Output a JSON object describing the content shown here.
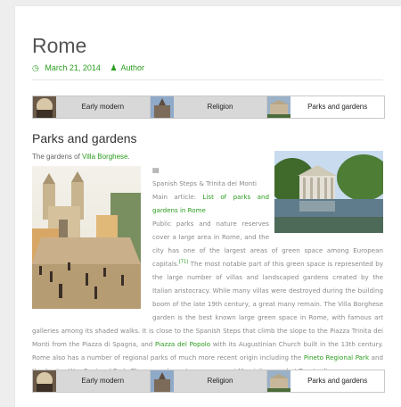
{
  "page": {
    "title": "Rome",
    "date": "March 21, 2014",
    "author": "Author"
  },
  "tabs": [
    {
      "label": "Early modern",
      "active": false
    },
    {
      "label": "Religion",
      "active": false
    },
    {
      "label": "Parks and gardens",
      "active": true
    }
  ],
  "section": {
    "heading": "Parks and gardens",
    "gardens_prefix": "The gardens of ",
    "gardens_link": "Villa Borghese",
    "gardens_suffix": ".",
    "caption": "Spanish Steps & Trinita dei Monti",
    "main_article_prefix": "Main article: ",
    "main_article_link": "List of parks and gardens in Rome",
    "p1": "Public parks and nature reserves cover a large area in Rome, and the city has one of the largest areas of green space among European capitals.",
    "cite": "[71]",
    "p2": " The most notable part of this green space is represented by the large number of villas and landscaped gardens created by the Italian aristocracy. While many villas were destroyed during the building boom of the late 19th century, a great many remain. The Villa Borghese garden is the best known large green space in Rome, with famous art galleries among its shaded walks. It is close to the Spanish Steps that climb the slope to the Piazza Trinita dei Monti from the Piazza di Spagna, and ",
    "link_popolo": "Piazza del Popolo",
    "p3": " with its Augustinian Church built in the 13th century. Rome also has a number of regional parks of much more recent origin including the ",
    "link_pineto": "Pineto Regional Park",
    "p4": " and the Appian Way Regional Park. There are also nature reserves at Marcigliana and at Tenuta di"
  },
  "colors": {
    "accent": "#2a9d1e",
    "tab_inactive": "#d8d8d8",
    "text": "#8a8a8a"
  },
  "icons": {
    "date": "clock-icon",
    "author": "user-icon",
    "caption": "image-caption-icon"
  }
}
